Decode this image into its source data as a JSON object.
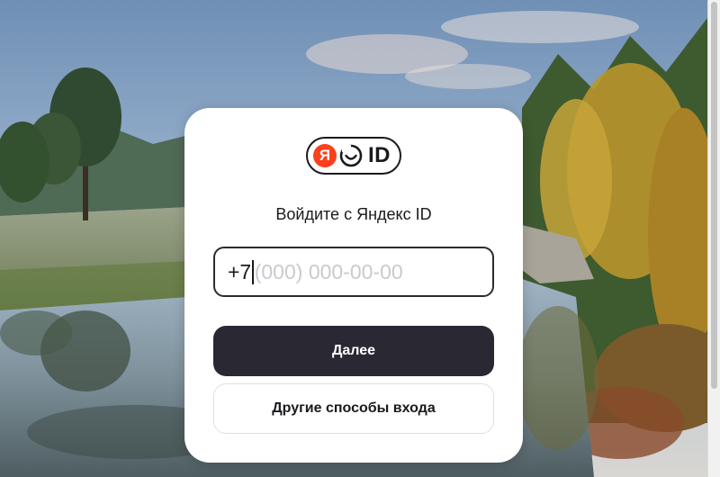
{
  "logo": {
    "ya_letter": "Я",
    "id_text": "ID",
    "accent_color": "#fc3f1d"
  },
  "login": {
    "title": "Войдите с Яндекс ID",
    "phone_prefix": "+7",
    "phone_placeholder": "(000) 000-00-00",
    "next_label": "Далее",
    "other_methods_label": "Другие способы входа"
  },
  "icons": {
    "logo": "yandex-id-logo",
    "face": "smile-face-icon"
  },
  "background": {
    "description_colors": [
      "#8fa9c4",
      "#3f5a3a",
      "#c9a23a",
      "#5c6f74"
    ]
  }
}
